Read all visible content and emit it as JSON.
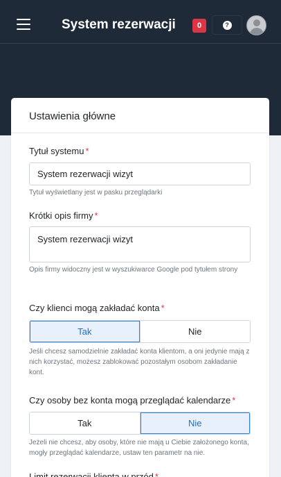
{
  "header": {
    "title": "System rezerwacji",
    "notification_count": "0",
    "help_glyph": "?"
  },
  "icons": [
    "menu-icon",
    "help-icon",
    "user-avatar-icon"
  ],
  "colors": {
    "navbar": "#1f2a38",
    "badge": "#dc3545",
    "active_option": "#2f80d0",
    "required": "#dc3545"
  },
  "card": {
    "title": "Ustawienia główne",
    "fields": {
      "system_title": {
        "label": "Tytuł systemu",
        "required_mark": "*",
        "value": "System rezerwacji wizyt",
        "hint": "Tytuł wyświetlany jest w pasku przeglądarki"
      },
      "company_description": {
        "label": "Krótki opis firmy",
        "required_mark": "*",
        "value": "System rezerwacji wizyt",
        "hint": "Opis firmy widoczny jest w wyszukiwarce Google pod tytułem strony"
      },
      "client_accounts": {
        "label": "Czy klienci mogą zakładać konta",
        "required_mark": "*",
        "options": [
          "Tak",
          "Nie"
        ],
        "selected": "Tak",
        "hint": "Jeśli chcesz samodzielnie zakładać konta klientom, a oni jedynie mają z nich korzystać, możesz zablokować pozostałym osobom zakładanie kont."
      },
      "guest_calendar": {
        "label": "Czy osoby bez konta mogą przeglądać kalendarze",
        "required_mark": "*",
        "options": [
          "Tak",
          "Nie"
        ],
        "selected": "Nie",
        "hint": "Jeżeli nie chcesz, aby osoby, które nie mają u Ciebie założonego konta, mogły przeglądać kalendarze, ustaw ten parametr na nie."
      },
      "booking_limit": {
        "label": "Limit rezerwacji klienta w przód",
        "required_mark": "*"
      }
    }
  }
}
